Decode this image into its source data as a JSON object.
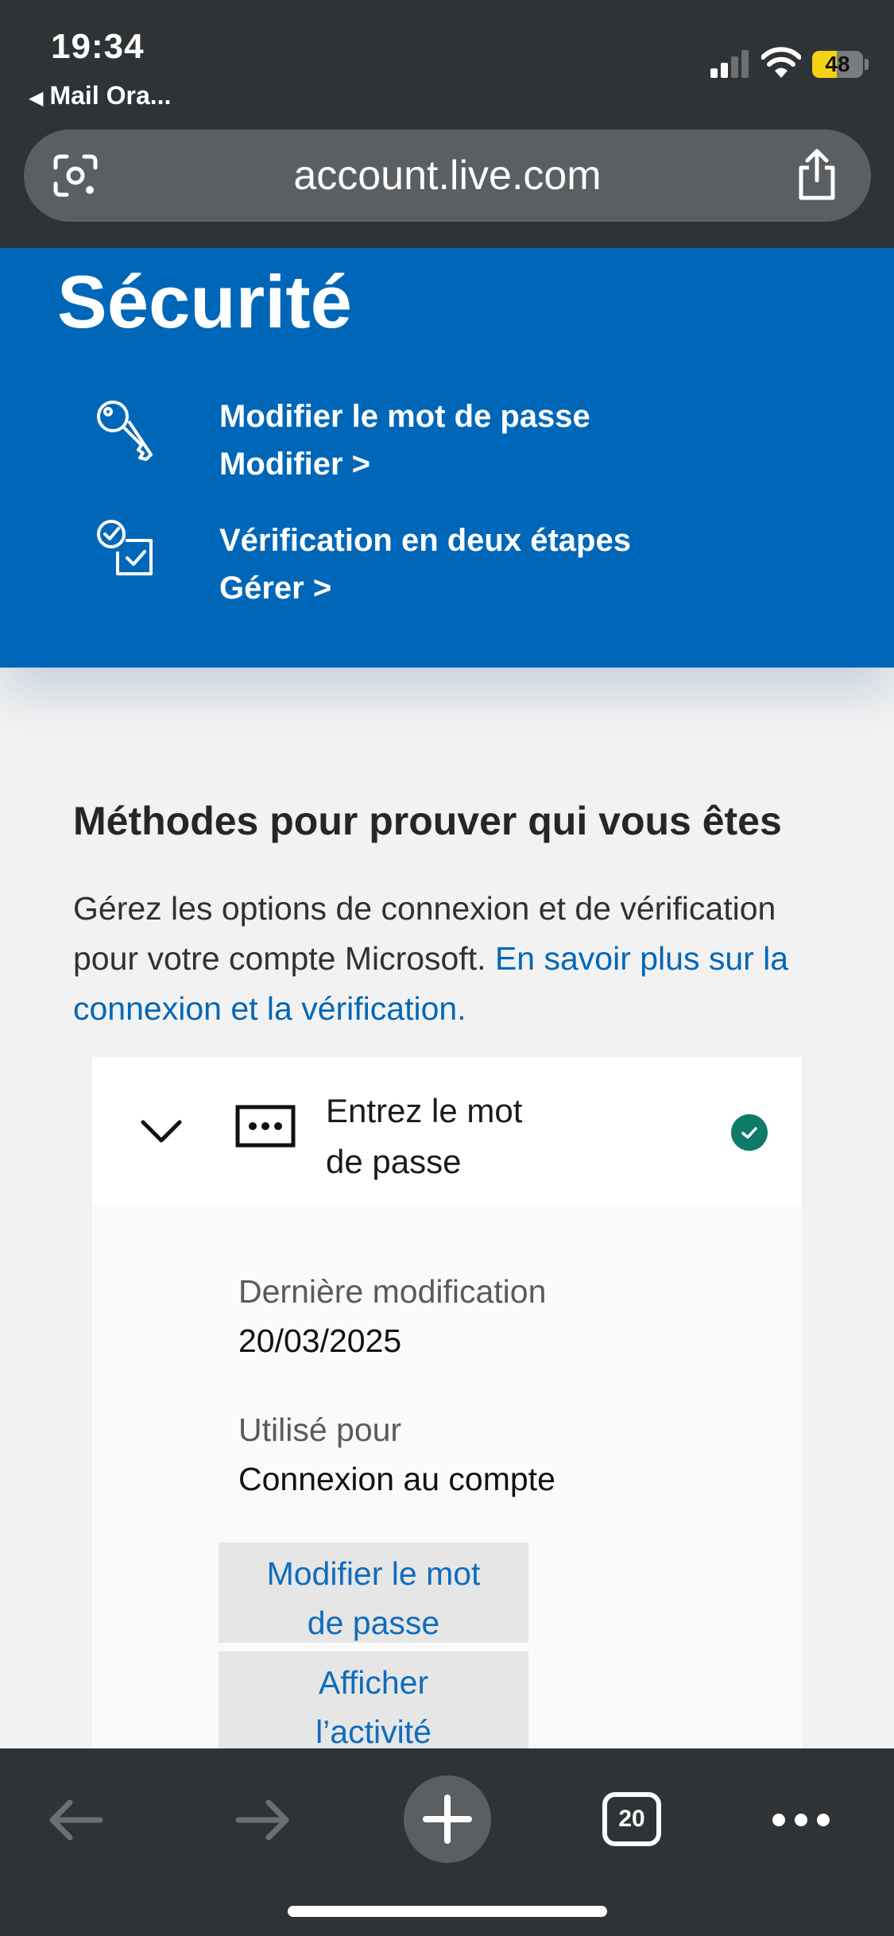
{
  "status_bar": {
    "time": "19:34",
    "back_app": "Mail Ora...",
    "battery_level": "48",
    "battery_fraction": 0.48,
    "signal_bars_active": 2
  },
  "browser": {
    "url": "account.live.com",
    "open_tabs": "20"
  },
  "security": {
    "title": "Sécurité",
    "rows": [
      {
        "icon": "key-icon",
        "line1": "Modifier le mot de passe",
        "line2": "Modifier >"
      },
      {
        "icon": "two-step-verification-icon",
        "line1": "Vérification en deux étapes",
        "line2": "Gérer >"
      }
    ]
  },
  "methods": {
    "title": "Méthodes pour prouver qui vous êtes",
    "description": "Gérez les options de connexion et de vérification pour votre compte Microsoft.",
    "learn_more_link": "En savoir plus sur la connexion et la vérification."
  },
  "password_method": {
    "name": "Entrez le mot de passe",
    "status": "verified",
    "last_modified_label": "Dernière modification",
    "last_modified_value": "20/03/2025",
    "used_for_label": "Utilisé pour",
    "used_for_value": "Connexion au compte",
    "change_button": "Modifier le mot de passe",
    "activity_button": "Afficher l’activité"
  },
  "colors": {
    "security_blue": "#0067b8",
    "link_blue": "#0f6cbd",
    "check_green": "#0e7a67",
    "chrome_dark": "#2f3336"
  }
}
